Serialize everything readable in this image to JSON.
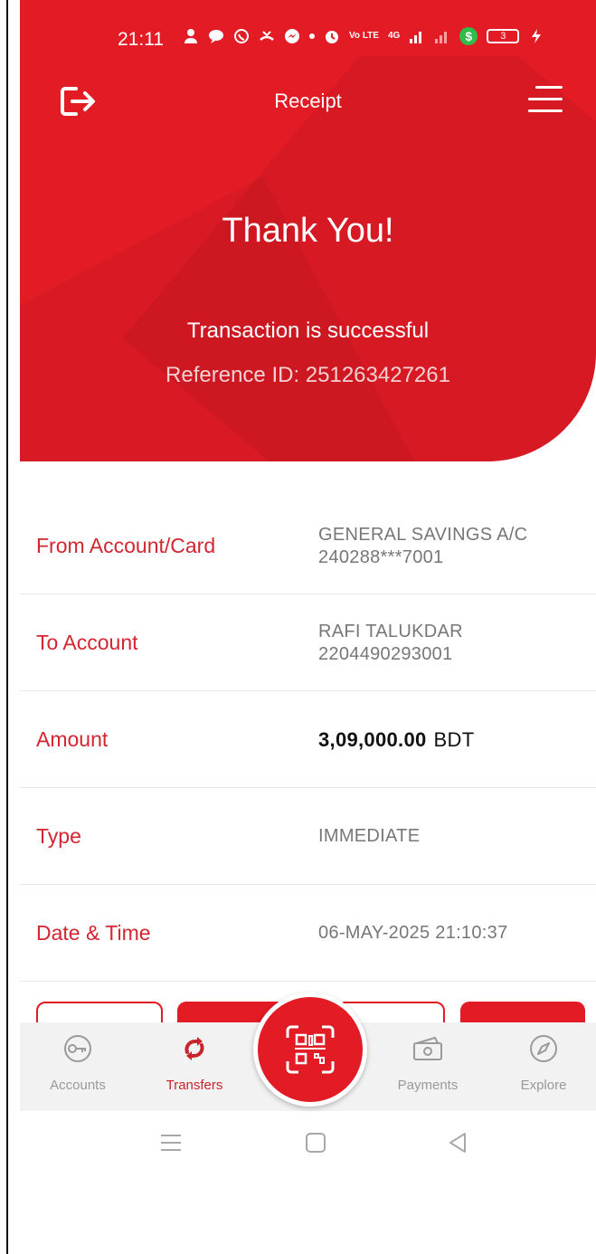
{
  "status_bar": {
    "time": "21:11",
    "carrier_labels": [
      "Vo LTE",
      "4G"
    ],
    "green_badge": "$",
    "battery": "3"
  },
  "header": {
    "title": "Receipt",
    "heading": "Thank You!",
    "status": "Transaction is successful",
    "reference": "Reference ID: 251263427261",
    "background_color": "#e21b25"
  },
  "details": [
    {
      "label": "From Account/Card",
      "value_line1": "GENERAL SAVINGS A/C",
      "value_line2": "240288***7001"
    },
    {
      "label": "To Account",
      "value_line1": "RAFI TALUKDAR",
      "value_line2": "2204490293001"
    },
    {
      "label": "Amount",
      "amount": "3,09,000.00",
      "currency": "BDT"
    },
    {
      "label": "Type",
      "value_line1": "IMMEDIATE"
    },
    {
      "label": "Date & Time",
      "value_line1": "06-MAY-2025 21:10:37"
    }
  ],
  "bottom_nav": {
    "items": [
      {
        "label": "Accounts",
        "icon": "key-icon"
      },
      {
        "label": "Transfers",
        "icon": "transfer-arrows-icon",
        "active": true
      },
      {
        "label": "Payments",
        "icon": "cash-icon"
      },
      {
        "label": "Explore",
        "icon": "compass-icon"
      }
    ],
    "center_icon": "qr-scan-icon",
    "active_color": "#c8242c"
  },
  "system_nav": {
    "icons": [
      "recents-icon",
      "home-icon",
      "back-icon"
    ]
  }
}
